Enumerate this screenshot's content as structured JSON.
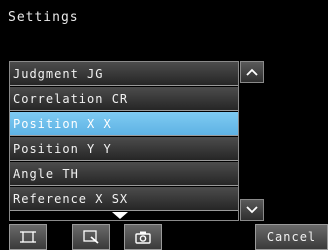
{
  "title": "Settings",
  "list": {
    "items": [
      {
        "label": "Judgment JG"
      },
      {
        "label": "Correlation CR"
      },
      {
        "label": "Position X X"
      },
      {
        "label": "Position Y Y"
      },
      {
        "label": "Angle TH"
      },
      {
        "label": "Reference X SX"
      }
    ],
    "selected_index": 2
  },
  "scrollbar": {
    "up_icon": "chevron-up-icon",
    "down_icon": "chevron-down-icon"
  },
  "toolbar": {
    "buttons": [
      {
        "icon": "fit-frame-icon"
      },
      {
        "icon": "zoom-icon"
      },
      {
        "icon": "camera-icon"
      }
    ],
    "cancel_label": "Cancel"
  },
  "colors": {
    "selected": "#6ec0ec",
    "item_bg": "#3a3a3a",
    "background": "#000000",
    "text": "#f2f2f2"
  }
}
